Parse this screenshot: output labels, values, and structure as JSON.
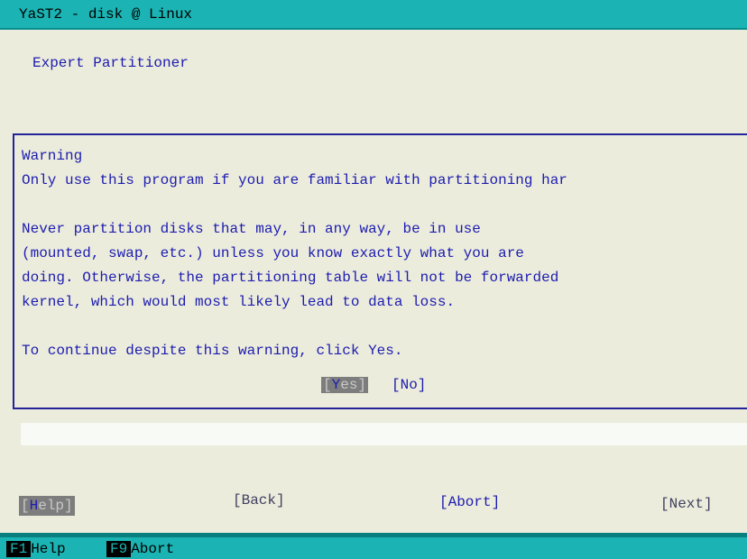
{
  "window": {
    "title": "YaST2 - disk @ Linux"
  },
  "heading": "Expert Partitioner",
  "dialog": {
    "lines": [
      "Warning",
      "Only use this program if you are familiar with partitioning har",
      "",
      "Never partition disks that may, in any way, be in use",
      "(mounted, swap, etc.) unless you know exactly what you are",
      "doing. Otherwise, the partitioning table will not be forwarded",
      "kernel, which would most likely lead to data loss.",
      "",
      "To continue despite this warning, click Yes."
    ],
    "yes_open": "[",
    "yes_hot": "Y",
    "yes_rest": "es]",
    "no_label": "[No]"
  },
  "nav": {
    "help_open": "[",
    "help_hot": "H",
    "help_rest": "elp]",
    "back": "[Back]",
    "abort": "[Abort]",
    "next": "[Next]"
  },
  "status": {
    "f1_key": "F1",
    "f1_label": "Help",
    "f9_key": "F9",
    "f9_label": "Abort"
  },
  "colors": {
    "background": "#ececdc",
    "accent": "#1bb3b3",
    "text": "#1c1cb0",
    "focus_button": "#7d7d7d"
  }
}
